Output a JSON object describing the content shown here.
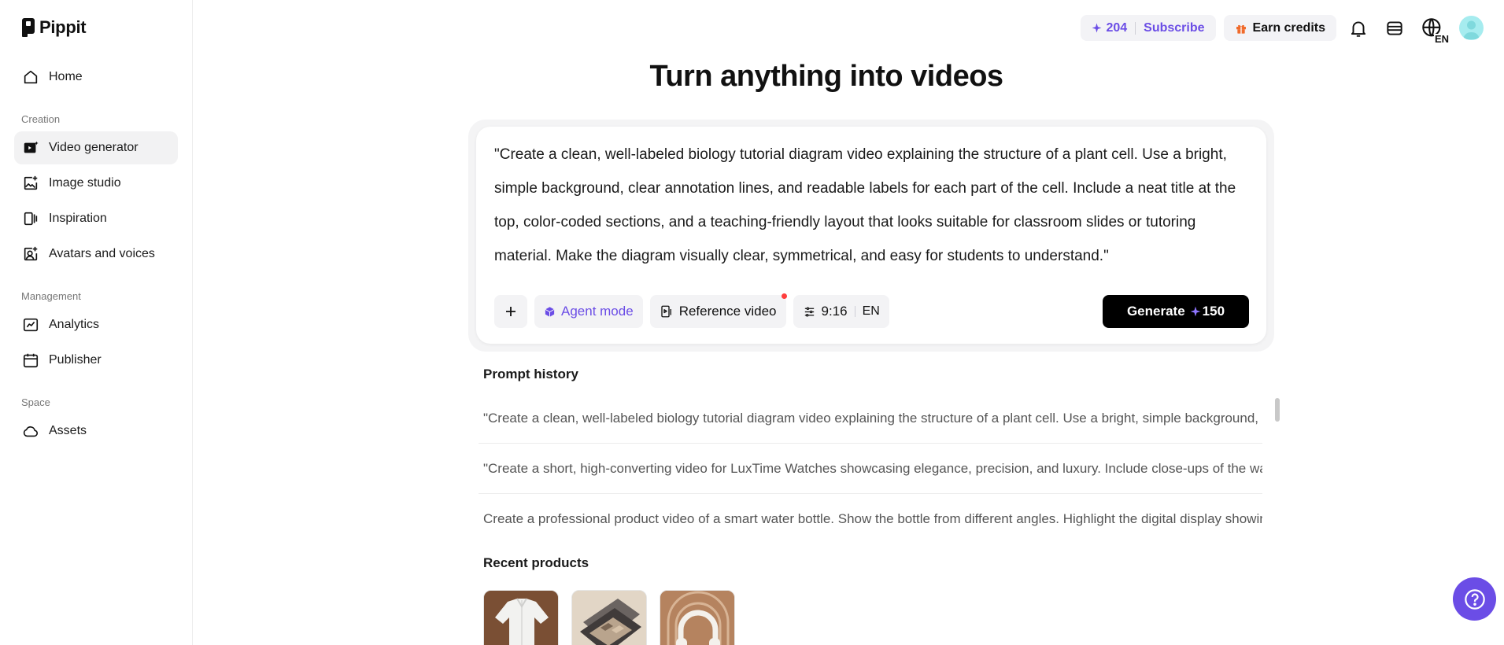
{
  "brand": {
    "name": "Pippit"
  },
  "sidebar": {
    "home": "Home",
    "sections": {
      "creation": "Creation",
      "management": "Management",
      "space": "Space"
    },
    "items": {
      "video_generator": "Video generator",
      "image_studio": "Image studio",
      "inspiration": "Inspiration",
      "avatars": "Avatars and voices",
      "analytics": "Analytics",
      "publisher": "Publisher",
      "assets": "Assets"
    },
    "active_item": "Video generator"
  },
  "topbar": {
    "credits": "204",
    "subscribe": "Subscribe",
    "earn_credits": "Earn credits",
    "language": "EN"
  },
  "main": {
    "title": "Turn anything into videos",
    "prompt": "\"Create a clean, well-labeled biology tutorial diagram video explaining the structure of a plant cell. Use a bright, simple background, clear annotation lines, and readable labels for each part of the cell. Include a neat title at the top, color-coded sections, and a teaching-friendly layout that looks suitable for classroom slides or tutoring material. Make the diagram visually clear, symmetrical, and easy for students to understand.\"",
    "tools": {
      "plus": "+",
      "agent_mode": "Agent mode",
      "reference_video": "Reference video",
      "aspect_ratio": "9:16",
      "language": "EN"
    },
    "generate": {
      "label": "Generate",
      "cost": "150"
    }
  },
  "prompt_history": {
    "heading": "Prompt history",
    "items": [
      "\"Create a clean, well-labeled biology tutorial diagram video explaining the structure of a plant cell. Use a bright, simple background, cl",
      "\"Create a short, high-converting video for LuxTime Watches showcasing elegance, precision, and luxury. Include close-ups of the watc",
      "Create a professional product video of a smart water bottle. Show the bottle from different angles. Highlight the digital display showin"
    ]
  },
  "recent_products": {
    "heading": "Recent products",
    "items": [
      {
        "name": "white-shirt",
        "color": "#8a5a3c"
      },
      {
        "name": "eyeshadow-palette",
        "color": "#cbbfae"
      },
      {
        "name": "headphones",
        "color": "#b07a52"
      }
    ]
  },
  "colors": {
    "accent": "#6b4de6",
    "generate_bg": "#000000",
    "avatar": "#a6ecef",
    "notification_dot": "#ff3d3d"
  }
}
